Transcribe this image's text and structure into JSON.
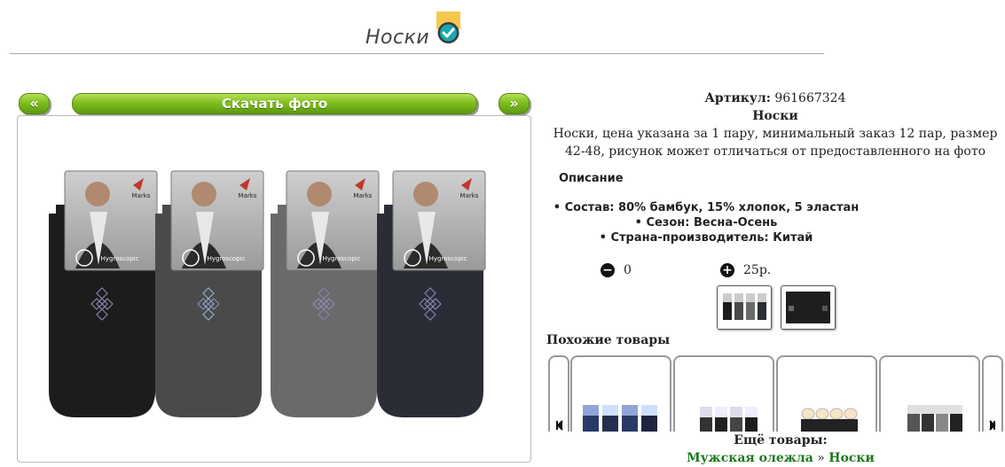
{
  "page_title": "Носки",
  "gallery": {
    "prev_label": "«",
    "download_label": "Скачать фото",
    "next_label": "»",
    "pack_brand": "Marks",
    "pack_text": "Hygroscopic"
  },
  "product": {
    "article_label": "Артикул:",
    "article_value": "961667324",
    "name": "Носки",
    "summary": "Носки, цена указана за 1 пару, минимальный заказ 12 пар, размер 42-48, рисунок может отличаться от предоставленного на фото",
    "description_heading": "Описание",
    "props": [
      "Состав: 80% бамбук, 15% хлопок, 5 эластан",
      "Сезон: Весна-Осень",
      "Страна-производитель: Китай"
    ]
  },
  "order": {
    "minus_symbol": "−",
    "quantity": "0",
    "plus_symbol": "+",
    "price": "25р."
  },
  "similar": {
    "heading": "Похожие товары"
  },
  "more": {
    "heading": "Ещё товары:",
    "category_link": "Мужская олежла",
    "separator": "»",
    "current_link": "Носки"
  },
  "colors": {
    "accent_green": "#6fb31a",
    "link_green": "#1b7a1b",
    "sock_colors": [
      "#1c1c1c",
      "#4a4a4a",
      "#6a6a6a",
      "#2a2d36"
    ]
  }
}
